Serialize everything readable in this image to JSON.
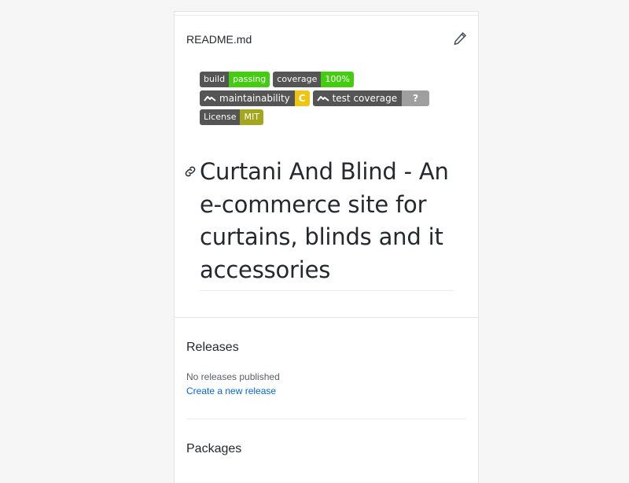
{
  "readme": {
    "filename": "README.md",
    "edit_icon": "pencil-icon"
  },
  "badges": {
    "build": {
      "label": "build",
      "value": "passing",
      "color": "#4c1"
    },
    "coverage": {
      "label": "coverage",
      "value": "100%",
      "color": "#4c1"
    },
    "maintainability": {
      "label": "maintainability",
      "value": "C",
      "color": "#f1c40f",
      "icon": "codeclimate-icon"
    },
    "test_coverage": {
      "label": "test coverage",
      "value": "?",
      "color": "#9f9f9f",
      "icon": "codeclimate-icon"
    },
    "license": {
      "label": "License",
      "value": "MIT",
      "color": "#a4a61d"
    }
  },
  "heading": {
    "text": "Curtani And Blind - An e-commerce site for curtains, blinds and it accessories",
    "anchor_icon": "link-icon"
  },
  "releases": {
    "title": "Releases",
    "empty_text": "No releases published",
    "create_link": "Create a new release"
  },
  "packages": {
    "title": "Packages"
  }
}
